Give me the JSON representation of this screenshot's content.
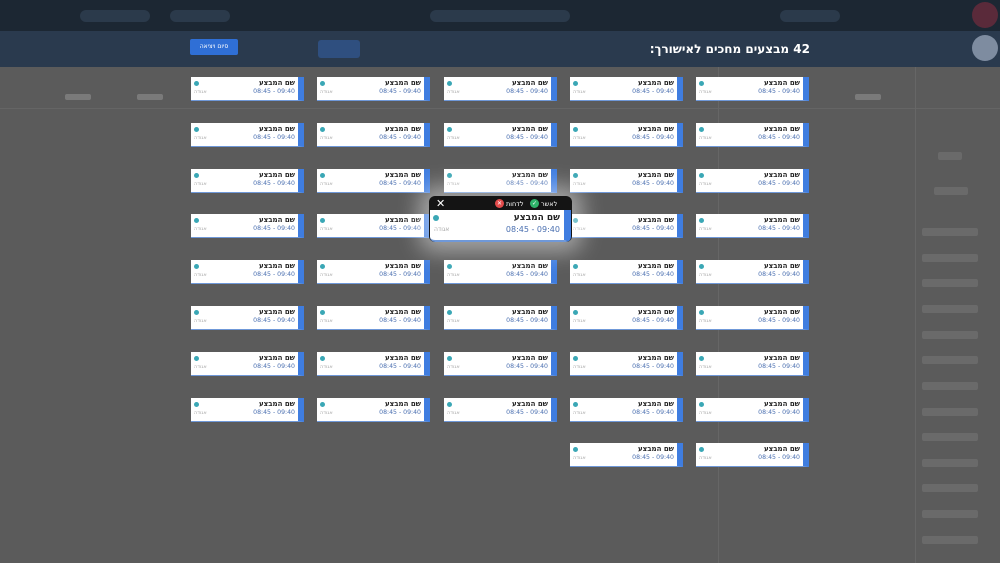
{
  "overlay": {
    "title": "42 מבצעים מחכים לאישורך:",
    "finish_label": "סיום ויציאה"
  },
  "card_template": {
    "name": "שם המבצע",
    "time": "08:45 - 09:40",
    "team": "אגודה"
  },
  "cards": {
    "columns": 5,
    "counts_per_column": [
      8,
      8,
      8,
      9,
      9
    ]
  },
  "focused_card": {
    "name": "שם המבצע",
    "time": "08:45 - 09:40",
    "team": "אגודה",
    "approve_label": "לאשר",
    "reject_label": "לדחות",
    "close_icon": "close-icon"
  },
  "colors": {
    "accent": "#3f7de0",
    "approve": "#2fb36a",
    "reject": "#e24b4b",
    "dot": "#3aa7b5"
  }
}
